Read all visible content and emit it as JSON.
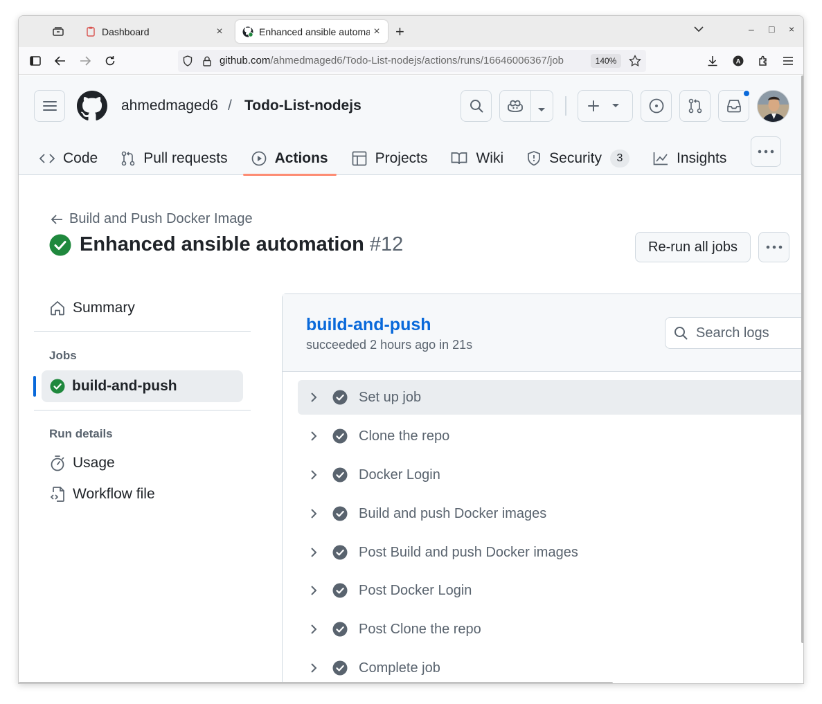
{
  "browser": {
    "tabs": [
      {
        "title": "Dashboard",
        "close": "×"
      },
      {
        "title": "Enhanced ansible automa",
        "close": "×"
      }
    ],
    "new_tab": "+",
    "url_host": "github.com",
    "url_path": "/ahmedmaged6/Todo-List-nodejs/actions/runs/16646006367/job",
    "zoom": "140%",
    "window_controls": [
      "–",
      "□",
      "×"
    ]
  },
  "repo_header": {
    "owner": "ahmedmaged6",
    "separator": "/",
    "repo": "Todo-List-nodejs",
    "nav": [
      {
        "label": "Code",
        "icon": "code-icon"
      },
      {
        "label": "Pull requests",
        "icon": "pull-request-icon"
      },
      {
        "label": "Actions",
        "icon": "play-icon",
        "active": true
      },
      {
        "label": "Projects",
        "icon": "table-icon"
      },
      {
        "label": "Wiki",
        "icon": "book-icon"
      },
      {
        "label": "Security",
        "icon": "shield-icon",
        "count": "3"
      },
      {
        "label": "Insights",
        "icon": "graph-icon"
      }
    ],
    "notification_dot_color": "#0969da"
  },
  "run": {
    "back_label": "Build and Push Docker Image",
    "title": "Enhanced ansible automation",
    "number": "#12",
    "rerun_label": "Re-run all jobs",
    "status_color": "#1f883d"
  },
  "sidebar": {
    "summary": "Summary",
    "jobs_heading": "Jobs",
    "job": "build-and-push",
    "run_details_heading": "Run details",
    "usage": "Usage",
    "workflow_file": "Workflow file"
  },
  "job": {
    "title": "build-and-push",
    "subtitle": "succeeded 2 hours ago in 21s",
    "search_placeholder": "Search logs",
    "steps": [
      "Set up job",
      "Clone the repo",
      "Docker Login",
      "Build and push Docker images",
      "Post Build and push Docker images",
      "Post Docker Login",
      "Post Clone the repo",
      "Complete job"
    ]
  }
}
